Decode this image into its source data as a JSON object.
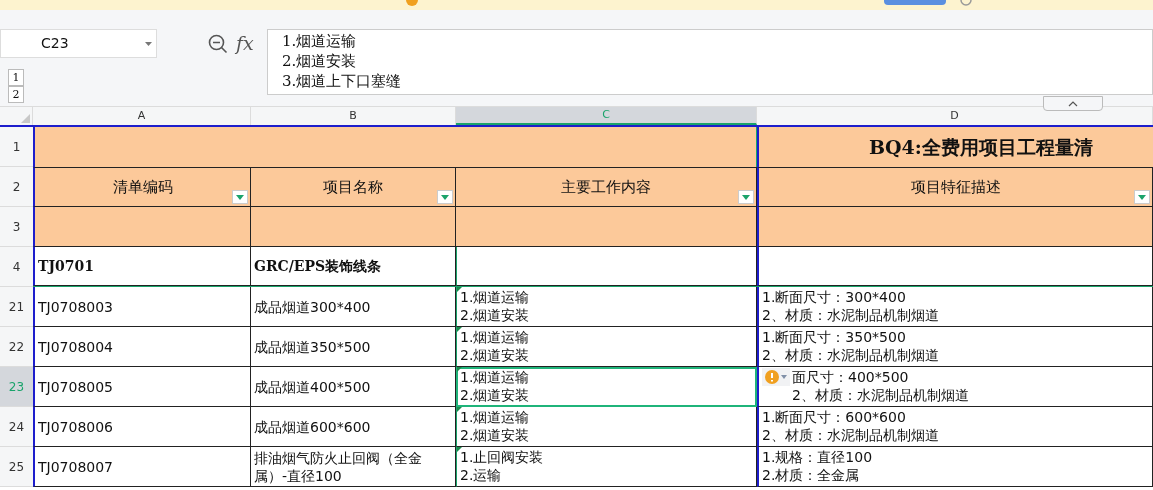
{
  "name_box": {
    "value": "C23"
  },
  "formula_bar": {
    "label": "fx",
    "value": "1.烟道运输\n2.烟道安装\n3.烟道上下口塞缝"
  },
  "outline_levels": [
    "1",
    "2"
  ],
  "columns": [
    {
      "label": "A",
      "selected": false
    },
    {
      "label": "B",
      "selected": false
    },
    {
      "label": "C",
      "selected": true
    },
    {
      "label": "D",
      "selected": false
    }
  ],
  "title_row": {
    "row": "1",
    "title": "BQ4:全费用项目工程量清"
  },
  "header_row": {
    "row": "2",
    "cells": [
      {
        "text": "清单编码",
        "filter": true
      },
      {
        "text": "项目名称",
        "filter": true
      },
      {
        "text": "主要工作内容",
        "filter": true
      },
      {
        "text": "项目特征描述",
        "filter": true
      }
    ]
  },
  "blank_row": {
    "row": "3"
  },
  "rows": [
    {
      "row": "4",
      "selected": false,
      "bold": true,
      "cells": [
        {
          "text": "TJ0701",
          "selected": false,
          "marker": false,
          "warning": false
        },
        {
          "text": "GRC/EPS装饰线条",
          "selected": false,
          "marker": false,
          "warning": false
        },
        {
          "selected": false,
          "marker": false,
          "warning": false
        },
        {
          "selected": false,
          "marker": false,
          "warning": false
        }
      ]
    },
    {
      "row": "21",
      "selected": false,
      "bold": false,
      "cells": [
        {
          "text": "TJ0708003",
          "selected": false,
          "marker": false,
          "warning": false
        },
        {
          "text": "成品烟道300*400",
          "selected": false,
          "marker": false,
          "warning": false
        },
        {
          "text": "1.烟道运输\n2.烟道安装",
          "selected": false,
          "marker": true,
          "warning": false
        },
        {
          "text": "1.断面尺寸：300*400\n2、材质：水泥制品机制烟道",
          "selected": false,
          "marker": false,
          "warning": false
        }
      ]
    },
    {
      "row": "22",
      "selected": false,
      "bold": false,
      "cells": [
        {
          "text": "TJ0708004",
          "selected": false,
          "marker": false,
          "warning": false
        },
        {
          "text": "成品烟道350*500",
          "selected": false,
          "marker": false,
          "warning": false
        },
        {
          "text": "1.烟道运输\n2.烟道安装",
          "selected": false,
          "marker": true,
          "warning": false
        },
        {
          "text": "1.断面尺寸：350*500\n2、材质：水泥制品机制烟道",
          "selected": false,
          "marker": false,
          "warning": false
        }
      ]
    },
    {
      "row": "23",
      "selected": true,
      "bold": false,
      "cells": [
        {
          "text": "TJ0708005",
          "selected": false,
          "marker": false,
          "warning": false
        },
        {
          "text": "成品烟道400*500",
          "selected": false,
          "marker": false,
          "warning": false
        },
        {
          "text": "1.烟道运输\n2.烟道安装",
          "selected": true,
          "marker": true,
          "warning": false
        },
        {
          "text": "面尺寸：400*500\n2、材质：水泥制品机制烟道",
          "selected": false,
          "marker": false,
          "warning": true
        }
      ]
    },
    {
      "row": "24",
      "selected": false,
      "bold": false,
      "cells": [
        {
          "text": "TJ0708006",
          "selected": false,
          "marker": false,
          "warning": false
        },
        {
          "text": "成品烟道600*600",
          "selected": false,
          "marker": false,
          "warning": false
        },
        {
          "text": "1.烟道运输\n2.烟道安装",
          "selected": false,
          "marker": true,
          "warning": false
        },
        {
          "text": "1.断面尺寸：600*600\n2、材质：水泥制品机制烟道",
          "selected": false,
          "marker": false,
          "warning": false
        }
      ]
    },
    {
      "row": "25",
      "selected": false,
      "bold": false,
      "cells": [
        {
          "text": "TJ0708007",
          "selected": false,
          "marker": false,
          "warning": false
        },
        {
          "text": "排油烟气防火止回阀（全金属）-直径100",
          "selected": false,
          "marker": false,
          "warning": false
        },
        {
          "text": "1.止回阀安装\n2.运输",
          "selected": false,
          "marker": true,
          "warning": false
        },
        {
          "text": "1.规格：直径100\n2.材质：全金属",
          "selected": false,
          "marker": false,
          "warning": false
        }
      ]
    }
  ]
}
